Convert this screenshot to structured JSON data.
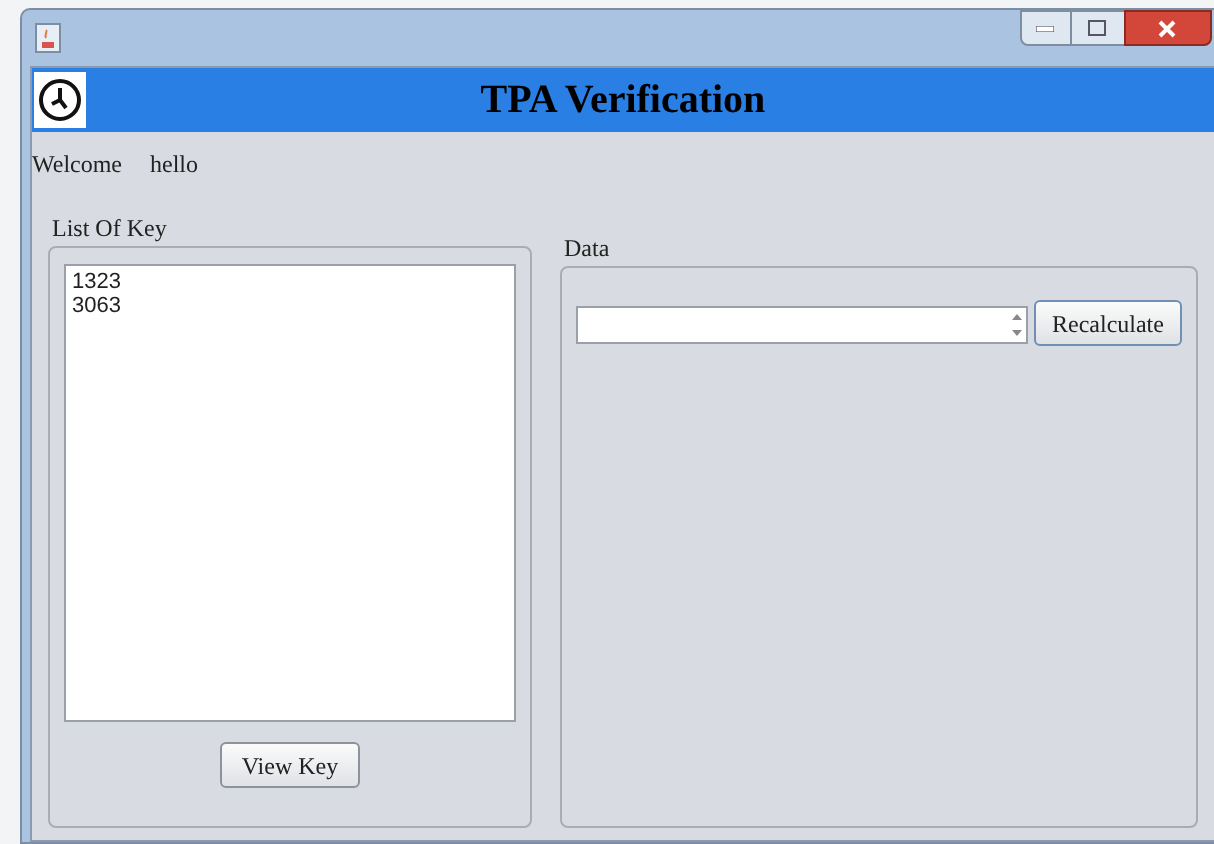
{
  "header": {
    "title": "TPA Verification"
  },
  "welcome": {
    "label": "Welcome",
    "user": "hello"
  },
  "key_panel": {
    "title": "List Of Key",
    "keys": [
      "1323",
      "3063"
    ],
    "button": "View Key"
  },
  "data_panel": {
    "title": "Data",
    "button": "Recalculate"
  }
}
